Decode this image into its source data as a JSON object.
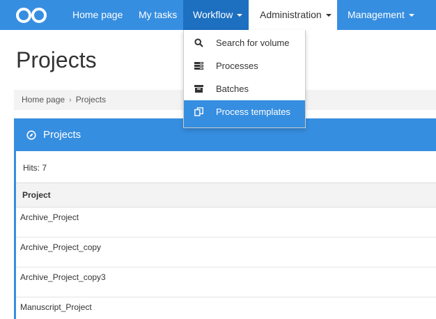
{
  "navbar": {
    "items": [
      {
        "label": "Home page"
      },
      {
        "label": "My tasks"
      },
      {
        "label": "Workflow"
      },
      {
        "label": "Administration"
      },
      {
        "label": "Management"
      }
    ]
  },
  "workflow_menu": {
    "items": [
      {
        "label": "Search for volume",
        "icon": "search-icon"
      },
      {
        "label": "Processes",
        "icon": "processes-icon"
      },
      {
        "label": "Batches",
        "icon": "batches-icon"
      },
      {
        "label": "Process templates",
        "icon": "templates-icon"
      }
    ]
  },
  "page": {
    "title": "Projects"
  },
  "breadcrumb": {
    "items": [
      "Home page",
      "Projects"
    ],
    "separator": "›"
  },
  "panel": {
    "title": "Projects",
    "hits": "Hits: 7",
    "column_header": "Project",
    "rows": [
      "Archive_Project",
      "Archive_Project_copy",
      "Archive_Project_copy3",
      "Manuscript_Project"
    ]
  },
  "colors": {
    "brand_blue": "#368ee0",
    "active_nav": "#1d6fc0"
  }
}
